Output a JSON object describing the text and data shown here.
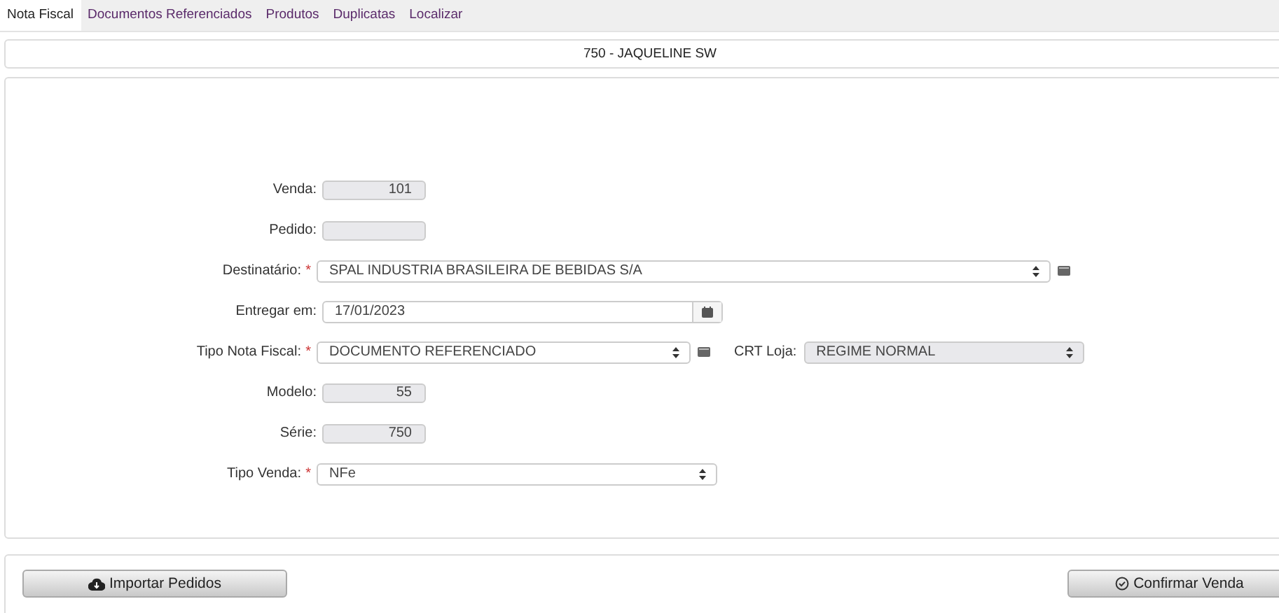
{
  "tabs": [
    {
      "label": "Nota Fiscal",
      "selected": true
    },
    {
      "label": "Documentos Referenciados",
      "selected": false
    },
    {
      "label": "Produtos",
      "selected": false
    },
    {
      "label": "Duplicatas",
      "selected": false
    },
    {
      "label": "Localizar",
      "selected": false
    }
  ],
  "header": {
    "title": "750 - JAQUELINE SW"
  },
  "fields": [
    {
      "kind": "readonly",
      "label": "Venda:",
      "value": "101"
    },
    {
      "kind": "readonly",
      "label": "Pedido:"
    },
    {
      "kind": "select",
      "label": "Destinatário:",
      "required_mark": "*",
      "value": "SPAL INDUSTRIA BRASILEIRA DE BEBIDAS S/A",
      "side_button": true
    },
    {
      "kind": "date",
      "label": "Entregar em:",
      "value": "17/01/2023"
    },
    {
      "kind": "select",
      "label": "Tipo Nota Fiscal:",
      "required_mark": "*",
      "value": "DOCUMENTO REFERENCIADO",
      "side_button": true,
      "extra": {
        "label": "CRT Loja:",
        "value": "REGIME NORMAL",
        "disabled": true
      }
    },
    {
      "kind": "readonly",
      "label": "Modelo:",
      "value": "55"
    },
    {
      "kind": "readonly",
      "label": "Série:",
      "value": "750"
    },
    {
      "kind": "select",
      "label": "Tipo Venda:",
      "required_mark": "*",
      "value": "NFe",
      "side_button": false
    }
  ],
  "buttons": [
    {
      "kind": "import",
      "label": "Importar Pedidos"
    },
    {
      "kind": "confirm",
      "label": "Confirmar Venda"
    }
  ]
}
